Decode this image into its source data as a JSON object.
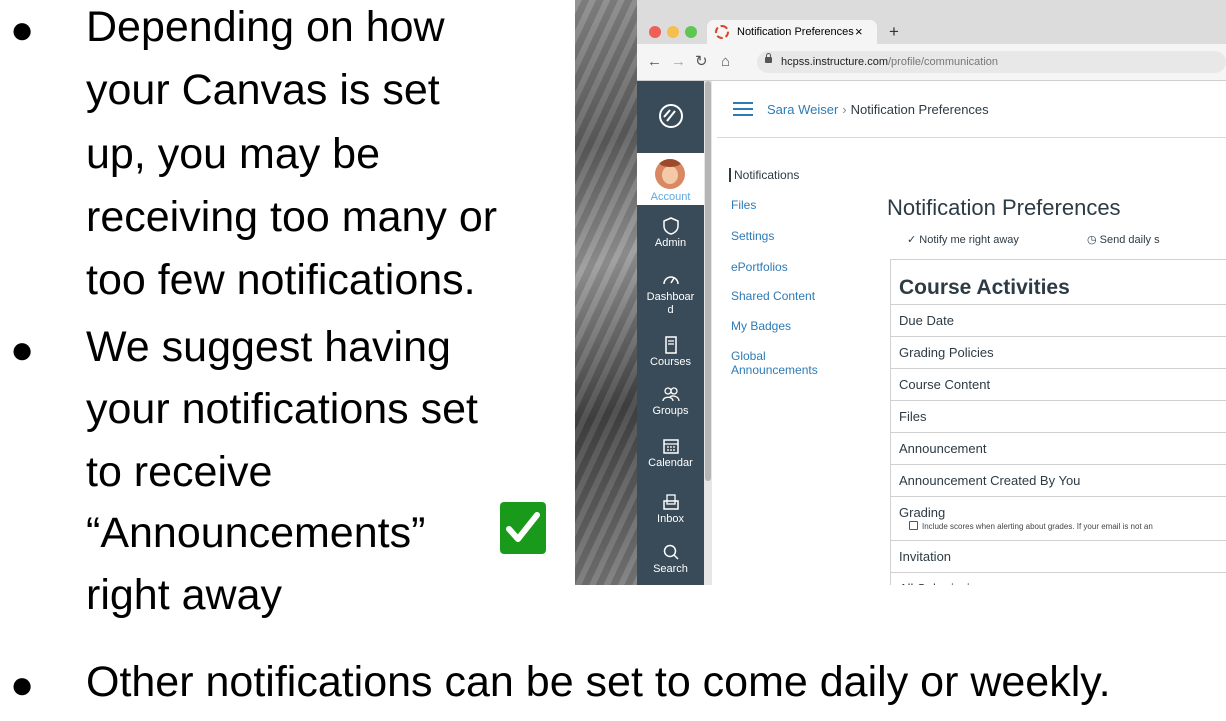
{
  "slide": {
    "bullets": [
      {
        "lines": [
          "Depending on how",
          "your Canvas is set",
          "up, you may be",
          "receiving too many or",
          "too few notifications."
        ]
      },
      {
        "lines": [
          "We suggest having",
          "your notifications set",
          "to receive",
          "“Announcements”",
          "right away"
        ]
      }
    ],
    "bottom_bullet": "Other notifications can be set to come daily or weekly.",
    "bullet_glyph": "●",
    "check_color": "#1a9a1a",
    "check_icon": "check-mark-icon"
  },
  "browser": {
    "tab_title": "Notification Preferences",
    "tab_close": "×",
    "new_tab": "+",
    "url_host": "hcpss.instructure.com",
    "url_path": "/profile/communication",
    "traffic_lights": [
      "#ed5f57",
      "#f4bf4f",
      "#5fc653"
    ]
  },
  "global_nav": {
    "account": "Account",
    "admin": "Admin",
    "dashboard_1": "Dashboar",
    "dashboard_2": "d",
    "courses": "Courses",
    "groups": "Groups",
    "calendar": "Calendar",
    "inbox": "Inbox",
    "search": "Search",
    "background": "#394b58"
  },
  "breadcrumb": {
    "user": "Sara Weiser",
    "separator": "›",
    "page": "Notification Preferences"
  },
  "left_nav": {
    "items": [
      "Notifications",
      "Files",
      "Settings",
      "ePortfolios",
      "Shared Content",
      "My Badges"
    ],
    "global_1": "Global",
    "global_2": "Announcements"
  },
  "main": {
    "title": "Notification Preferences",
    "legend_1": "✓ Notify me right away",
    "legend_2": "◷ Send daily s",
    "section": "Course Activities",
    "rows": [
      "Due Date",
      "Grading Policies",
      "Course Content",
      "Files",
      "Announcement",
      "Announcement Created By You"
    ],
    "grading": "Grading",
    "grading_sub": "Include scores when alerting about grades. If your email is not an",
    "rows2": [
      "Invitation",
      "All Submissions"
    ]
  }
}
